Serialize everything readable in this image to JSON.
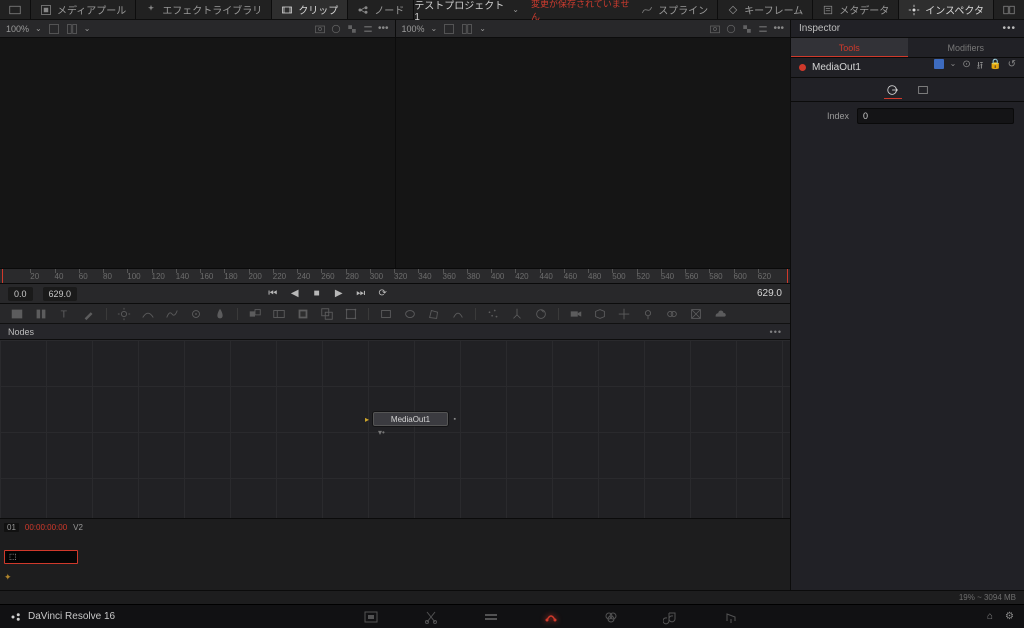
{
  "topbar": {
    "media_pool": "メディアプール",
    "effect_lib": "エフェクトライブラリ",
    "clips": "クリップ",
    "nodes": "ノード",
    "project_title": "テストプロジェクト1",
    "unsaved": "変更が保存されていません",
    "spline": "スプライン",
    "keyframes": "キーフレーム",
    "metadata": "メタデータ",
    "inspector": "インスペクタ"
  },
  "viewers": {
    "left_zoom": "100%",
    "right_zoom": "100%"
  },
  "ruler": {
    "ticks": [
      20,
      40,
      60,
      80,
      100,
      120,
      140,
      160,
      180,
      200,
      220,
      240,
      260,
      280,
      300,
      320,
      340,
      360,
      380,
      400,
      420,
      440,
      460,
      480,
      500,
      520,
      540,
      560,
      580,
      600,
      620
    ]
  },
  "transport": {
    "current": "0.0",
    "total": "629.0",
    "total_right": "629.0"
  },
  "nodes_panel": {
    "title": "Nodes",
    "node_label": "MediaOut1"
  },
  "clips": {
    "index": "01",
    "timecode": "00:00:00:00",
    "track": "V2",
    "badge": "⬚"
  },
  "inspector": {
    "title": "Inspector",
    "tab_tools": "Tools",
    "tab_modifiers": "Modifiers",
    "node_name": "MediaOut1",
    "field_index_label": "Index",
    "field_index_value": "0"
  },
  "status": {
    "text": "19% ~ 3094 MB"
  },
  "footer": {
    "brand": "DaVinci Resolve 16"
  }
}
